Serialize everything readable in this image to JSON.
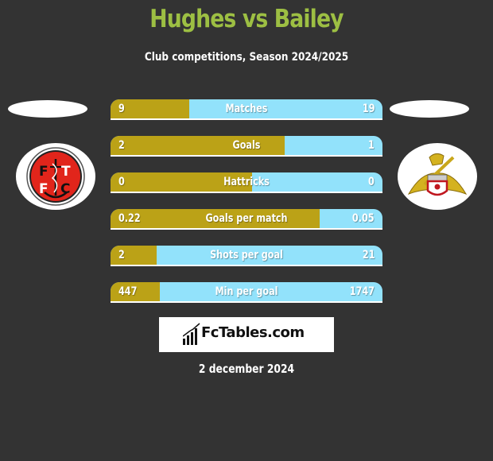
{
  "header": {
    "title": "Hughes vs Bailey",
    "subtitle": "Club competitions, Season 2024/2025"
  },
  "players": {
    "left": {
      "name": "Hughes",
      "club_logo": "fleetwood-town-fc-crest"
    },
    "right": {
      "name": "Bailey",
      "club_logo": "doncaster-rovers-crest"
    }
  },
  "colors": {
    "background": "#333333",
    "title": "#9dbf43",
    "left_bar": "#bba217",
    "right_bar": "#92e2fb",
    "text": "#ffffff"
  },
  "stats": [
    {
      "label": "Matches",
      "left": "9",
      "right": "19",
      "left_share": 0.29
    },
    {
      "label": "Goals",
      "left": "2",
      "right": "1",
      "left_share": 0.64
    },
    {
      "label": "Hattricks",
      "left": "0",
      "right": "0",
      "left_share": 0.52
    },
    {
      "label": "Goals per match",
      "left": "0.22",
      "right": "0.05",
      "left_share": 0.77
    },
    {
      "label": "Shots per goal",
      "left": "2",
      "right": "21",
      "left_share": 0.17
    },
    {
      "label": "Min per goal",
      "left": "447",
      "right": "1747",
      "left_share": 0.18
    }
  ],
  "brand": {
    "text": "FcTables.com",
    "icon": "bar-chart-icon"
  },
  "footer": {
    "date": "2 december 2024"
  }
}
